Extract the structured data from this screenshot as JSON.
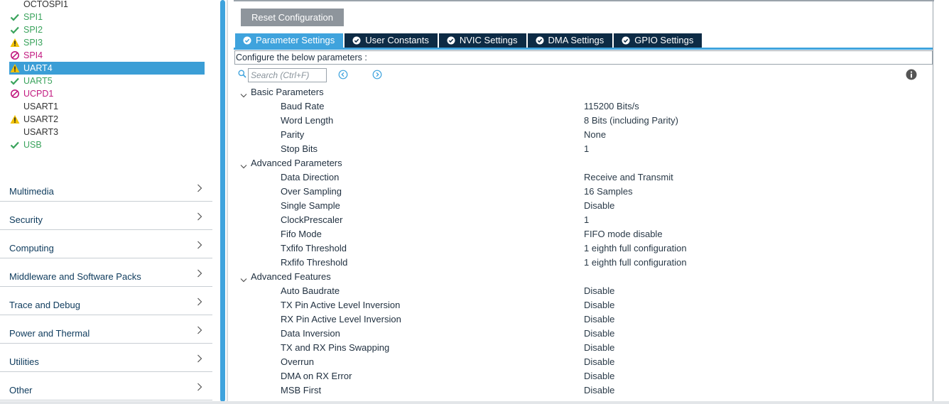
{
  "peripherals": [
    {
      "name": "OCTOSPI1",
      "status": "none"
    },
    {
      "name": "SPI1",
      "status": "ok"
    },
    {
      "name": "SPI2",
      "status": "ok"
    },
    {
      "name": "SPI3",
      "status": "warn"
    },
    {
      "name": "SPI4",
      "status": "bad"
    },
    {
      "name": "UART4",
      "status": "warn",
      "selected": true
    },
    {
      "name": "UART5",
      "status": "ok"
    },
    {
      "name": "UCPD1",
      "status": "bad"
    },
    {
      "name": "USART1",
      "status": "none"
    },
    {
      "name": "USART2",
      "status": "warn-plain"
    },
    {
      "name": "USART3",
      "status": "none"
    },
    {
      "name": "USB",
      "status": "ok"
    }
  ],
  "categories": [
    "Multimedia",
    "Security",
    "Computing",
    "Middleware and Software Packs",
    "Trace and Debug",
    "Power and Thermal",
    "Utilities",
    "Other"
  ],
  "toolbar": {
    "reset_label": "Reset Configuration"
  },
  "tabs": [
    {
      "label": "Parameter Settings",
      "active": true
    },
    {
      "label": "User Constants"
    },
    {
      "label": "NVIC Settings"
    },
    {
      "label": "DMA Settings"
    },
    {
      "label": "GPIO Settings"
    }
  ],
  "config_label": "Configure the below parameters :",
  "search": {
    "placeholder": "Search (Ctrl+F)"
  },
  "groups": [
    {
      "name": "Basic Parameters",
      "params": [
        {
          "name": "Baud Rate",
          "value": "115200 Bits/s"
        },
        {
          "name": "Word Length",
          "value": "8 Bits (including Parity)"
        },
        {
          "name": "Parity",
          "value": "None"
        },
        {
          "name": "Stop Bits",
          "value": "1"
        }
      ]
    },
    {
      "name": "Advanced Parameters",
      "params": [
        {
          "name": "Data Direction",
          "value": "Receive and Transmit"
        },
        {
          "name": "Over Sampling",
          "value": "16 Samples"
        },
        {
          "name": "Single Sample",
          "value": "Disable"
        },
        {
          "name": "ClockPrescaler",
          "value": "1"
        },
        {
          "name": "Fifo Mode",
          "value": "FIFO mode disable"
        },
        {
          "name": "Txfifo Threshold",
          "value": "1 eighth full configuration"
        },
        {
          "name": "Rxfifo Threshold",
          "value": "1 eighth full configuration"
        }
      ]
    },
    {
      "name": "Advanced Features",
      "params": [
        {
          "name": "Auto Baudrate",
          "value": "Disable"
        },
        {
          "name": "TX Pin Active Level Inversion",
          "value": "Disable"
        },
        {
          "name": "RX Pin Active Level Inversion",
          "value": "Disable"
        },
        {
          "name": "Data Inversion",
          "value": "Disable"
        },
        {
          "name": "TX and RX Pins Swapping",
          "value": "Disable"
        },
        {
          "name": "Overrun",
          "value": "Disable"
        },
        {
          "name": "DMA on RX Error",
          "value": "Disable"
        },
        {
          "name": "MSB First",
          "value": "Disable"
        }
      ]
    }
  ],
  "colors": {
    "accent": "#3fa3dd",
    "tab_dark": "#0d2b45",
    "ok": "#3aa35c",
    "warn": "#f2c200",
    "bad": "#c2187f"
  }
}
